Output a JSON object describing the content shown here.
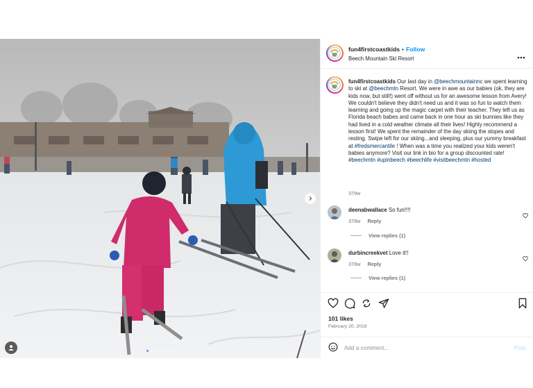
{
  "header": {
    "username": "fun4firstcoastkids",
    "separator": "•",
    "follow_label": "Follow",
    "location": "Beech Mountain Ski Resort",
    "more_icon": "more-horizontal-icon"
  },
  "caption": {
    "username": "fun4firstcoastkids",
    "text_1": " Our last day in ",
    "mention_1": "@beechmountainnc",
    "text_2": " we spent learning to ski at ",
    "mention_2": "@beechmtn",
    "text_3": " Resort. We were in awe as our babies (ok, they are kids now, but still!) went off without us for an awesome lesson from Avery! We couldn't believe they didn't need us and it was so fun to watch them learning and going up the magic carpet with their teacher. They left us as Florida beach babes and came back in one hour as ski bunnies like they had lived in a cold weather climate all their lives! Highly recommend a lesson first! We spent the remainder of the day skiing the slopes and resting. Swipe left for our skiing...and sleeping, plus our yummy breakfast at ",
    "mention_3": "#fredsmercantile",
    "text_4": " ! When was a time you realized your kids weren't babies anymore? Visit our link in bio for a group discounted rate! ",
    "tags": "#beechmtn #upinbeech #beechlife #visitbeechmtn #hosted",
    "time": "379w"
  },
  "comments": [
    {
      "username": "deenabwallace",
      "text": "So fun!!!!",
      "time": "378w",
      "reply_label": "Reply",
      "view_replies": "View replies (1)"
    },
    {
      "username": "durbincreekvet",
      "text": "Love it!!",
      "time": "378w",
      "reply_label": "Reply",
      "view_replies": "View replies (1)"
    }
  ],
  "actions": {
    "icons": [
      "heart-icon",
      "comment-icon",
      "share-icon",
      "send-icon",
      "bookmark-icon"
    ]
  },
  "likes": "101 likes",
  "date": "February 20, 2019",
  "add_comment": {
    "placeholder": "Add a comment...",
    "post_label": "Post"
  },
  "carousel": {
    "slide_count": 7,
    "active_index": 0
  },
  "colors": {
    "link": "#0095f6",
    "hashtag": "#00376b",
    "active_dot": "#4a9cf0"
  }
}
